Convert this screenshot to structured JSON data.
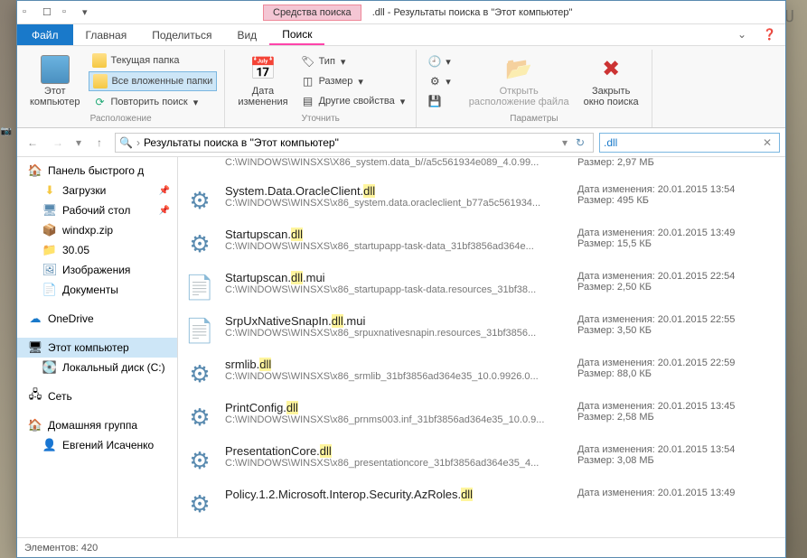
{
  "watermark": "WINDXP.COM.RU",
  "titlebar": {
    "contextual_tab": "Средства поиска",
    "title": ".dll - Результаты поиска в \"Этот компьютер\""
  },
  "menubar": {
    "file": "Файл",
    "tabs": [
      "Главная",
      "Поделиться",
      "Вид"
    ],
    "search_tab": "Поиск"
  },
  "ribbon": {
    "group_location": {
      "this_pc": "Этот\nкомпьютер",
      "current_folder": "Текущая папка",
      "all_subfolders": "Все вложенные папки",
      "repeat_search": "Повторить поиск",
      "label": "Расположение"
    },
    "group_refine": {
      "date_modified": "Дата\nизменения",
      "type": "Тип",
      "size": "Размер",
      "other_props": "Другие свойства",
      "label": "Уточнить"
    },
    "group_options": {
      "open_location": "Открыть\nрасположение файла",
      "close_search": "Закрыть\nокно поиска",
      "label": "Параметры"
    }
  },
  "addressbar": {
    "path": "Результаты поиска в \"Этот компьютер\"",
    "search_value": ".dll"
  },
  "sidebar": {
    "quick_access": {
      "label": "Панель быстрого д",
      "items": [
        {
          "icon": "⬇",
          "label": "Загрузки",
          "pinned": true,
          "color": "#f5c842"
        },
        {
          "icon": "🖥",
          "label": "Рабочий стол",
          "pinned": true,
          "color": "#5a8bb0"
        },
        {
          "icon": "📦",
          "label": "windxp.zip",
          "pinned": false,
          "color": "#f5c842"
        },
        {
          "icon": "📁",
          "label": "30.05",
          "pinned": false,
          "color": "#f5c842"
        },
        {
          "icon": "🖼",
          "label": "Изображения",
          "pinned": false,
          "color": "#5a8bb0"
        },
        {
          "icon": "📄",
          "label": "Документы",
          "pinned": false,
          "color": "#5a8bb0"
        }
      ]
    },
    "onedrive": {
      "icon": "☁",
      "label": "OneDrive"
    },
    "this_pc": {
      "icon": "🖥",
      "label": "Этот компьютер",
      "items": [
        {
          "icon": "💽",
          "label": "Локальный диск (C:)"
        }
      ]
    },
    "network": {
      "icon": "🖧",
      "label": "Сеть"
    },
    "homegroup": {
      "icon": "🏠",
      "label": "Домашняя группа",
      "items": [
        {
          "icon": "👤",
          "label": "Евгений Исаченко"
        }
      ]
    }
  },
  "results": {
    "partial_first": {
      "path": "C:\\WINDOWS\\WINSXS\\X86_system.data_b//a5c561934e089_4.0.99...",
      "meta2_label": "Размер:",
      "meta2_val": "2,97 МБ"
    },
    "items": [
      {
        "icon": "gear",
        "name_pre": "System.Data.OracleClient.",
        "name_hl": "dll",
        "name_post": "",
        "path": "C:\\WINDOWS\\WINSXS\\x86_system.data.oracleclient_b77a5c561934...",
        "date_label": "Дата изменения:",
        "date": "20.01.2015 13:54",
        "size_label": "Размер:",
        "size": "495 КБ"
      },
      {
        "icon": "gear",
        "name_pre": "Startupscan.",
        "name_hl": "dll",
        "name_post": "",
        "path": "C:\\WINDOWS\\WINSXS\\x86_startupapp-task-data_31bf3856ad364e...",
        "date_label": "Дата изменения:",
        "date": "20.01.2015 13:49",
        "size_label": "Размер:",
        "size": "15,5 КБ"
      },
      {
        "icon": "page",
        "name_pre": "Startupscan.",
        "name_hl": "dll",
        "name_post": ".mui",
        "path": "C:\\WINDOWS\\WINSXS\\x86_startupapp-task-data.resources_31bf38...",
        "date_label": "Дата изменения:",
        "date": "20.01.2015 22:54",
        "size_label": "Размер:",
        "size": "2,50 КБ"
      },
      {
        "icon": "page",
        "name_pre": "SrpUxNativeSnapIn.",
        "name_hl": "dll",
        "name_post": ".mui",
        "path": "C:\\WINDOWS\\WINSXS\\x86_srpuxnativesnapin.resources_31bf3856...",
        "date_label": "Дата изменения:",
        "date": "20.01.2015 22:55",
        "size_label": "Размер:",
        "size": "3,50 КБ"
      },
      {
        "icon": "gear",
        "name_pre": "srmlib.",
        "name_hl": "dll",
        "name_post": "",
        "path": "C:\\WINDOWS\\WINSXS\\x86_srmlib_31bf3856ad364e35_10.0.9926.0...",
        "date_label": "Дата изменения:",
        "date": "20.01.2015 22:59",
        "size_label": "Размер:",
        "size": "88,0 КБ"
      },
      {
        "icon": "gear",
        "name_pre": "PrintConfig.",
        "name_hl": "dll",
        "name_post": "",
        "path": "C:\\WINDOWS\\WINSXS\\x86_prnms003.inf_31bf3856ad364e35_10.0.9...",
        "date_label": "Дата изменения:",
        "date": "20.01.2015 13:45",
        "size_label": "Размер:",
        "size": "2,58 МБ"
      },
      {
        "icon": "gear",
        "name_pre": "PresentationCore.",
        "name_hl": "dll",
        "name_post": "",
        "path": "C:\\WINDOWS\\WINSXS\\x86_presentationcore_31bf3856ad364e35_4...",
        "date_label": "Дата изменения:",
        "date": "20.01.2015 13:54",
        "size_label": "Размер:",
        "size": "3,08 МБ"
      },
      {
        "icon": "gear",
        "name_pre": "Policy.1.2.Microsoft.Interop.Security.AzRoles.",
        "name_hl": "dll",
        "name_post": "",
        "path": "",
        "date_label": "Дата изменения:",
        "date": "20.01.2015 13:49",
        "size_label": "",
        "size": ""
      }
    ]
  },
  "statusbar": {
    "count_label": "Элементов:",
    "count": "420"
  }
}
